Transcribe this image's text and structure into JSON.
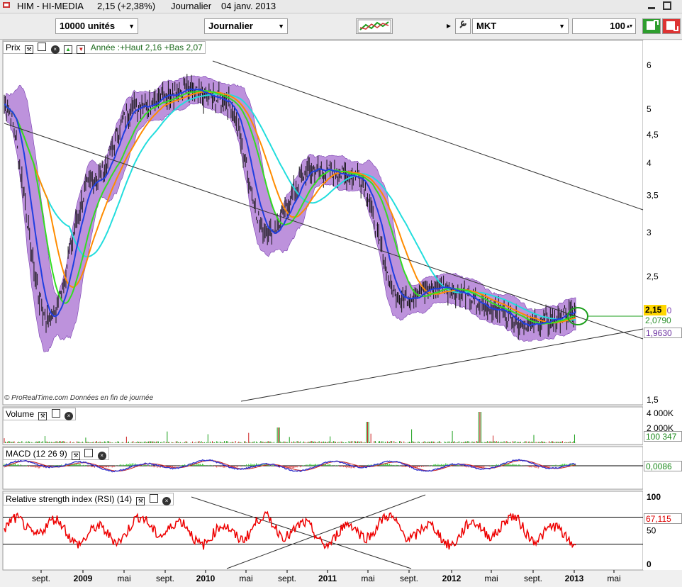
{
  "header": {
    "symbol": "HIM - HI-MEDIA",
    "price_change": "2,15 (+2,38%)",
    "timeframe": "Journalier",
    "date": "04 janv. 2013"
  },
  "toolbar": {
    "quantity": "10000 unités",
    "period": "Journalier",
    "order_type": "MKT",
    "order_qty": "100"
  },
  "panels": {
    "price": {
      "label": "Prix",
      "annotation": "Année :+Haut 2,16 +Bas 2,07",
      "copyright": "© ProRealTime.com  Données en fin de journée"
    },
    "volume": {
      "label": "Volume"
    },
    "macd": {
      "label": "MACD (12 26 9)"
    },
    "rsi": {
      "label": "Relative strength index (RSI) (14)"
    }
  },
  "right_labels": {
    "price_current": "2,15",
    "price_ma1": "2,0790",
    "price_ma2": "1,9630",
    "price_hidden": "90",
    "volume_current": "100 347",
    "macd_current": "0,0086",
    "rsi_current": "67,115"
  },
  "colors": {
    "ma_blue": "#1f3fe0",
    "ma_green": "#33dd22",
    "ma_orange": "#ff8c00",
    "ma_cyan": "#22dddd",
    "bollinger_fill": "#b27fd6",
    "rsi_line": "#ee0000",
    "macd_line": "#3333cc",
    "highlight_yellow": "#ffd700"
  },
  "chart_data": [
    {
      "type": "line",
      "title": "Prix",
      "x_ticks": [
        "sept.",
        "2009",
        "mai",
        "sept.",
        "2010",
        "mai",
        "sept.",
        "2011",
        "mai",
        "sept.",
        "2012",
        "mai",
        "sept.",
        "2013",
        "mai"
      ],
      "y_ticks": [
        "6",
        "5",
        "4,5",
        "4",
        "3,5",
        "3",
        "2,5",
        "1,5"
      ],
      "y_scale": "log",
      "ylim": [
        1.5,
        6.2
      ],
      "x": [
        "sept. 2008",
        "2009",
        "mai 2009",
        "sept. 2009",
        "2010",
        "mai 2010",
        "sept. 2010",
        "2011",
        "mai 2011",
        "sept. 2011",
        "2012",
        "mai 2012",
        "sept. 2012",
        "2013"
      ],
      "series": [
        {
          "values": [
            5.1,
            2.1,
            3.7,
            5.1,
            5.4,
            5.2,
            3.0,
            3.9,
            3.8,
            2.3,
            2.4,
            2.2,
            2.05,
            2.15
          ]
        }
      ]
    },
    {
      "type": "bar",
      "title": "Volume",
      "y_ticks": [
        "4 000K",
        "2 000K"
      ],
      "note": "daily volume histogram"
    },
    {
      "type": "line",
      "title": "MACD (12 26 9)",
      "current": 0.0086
    },
    {
      "type": "line",
      "title": "Relative strength index (RSI) (14)",
      "y_ticks": [
        "100",
        "50",
        "0"
      ],
      "ylim": [
        0,
        100
      ],
      "current": 67.115
    }
  ]
}
